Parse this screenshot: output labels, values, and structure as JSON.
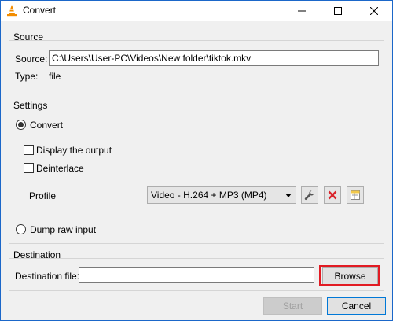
{
  "window": {
    "title": "Convert"
  },
  "source": {
    "group_title": "Source",
    "source_label": "Source:",
    "source_value": "C:\\Users\\User-PC\\Videos\\New folder\\tiktok.mkv",
    "type_label": "Type:",
    "type_value": "file"
  },
  "settings": {
    "group_title": "Settings",
    "convert_label": "Convert",
    "display_output_label": "Display the output",
    "deinterlace_label": "Deinterlace",
    "profile_label": "Profile",
    "profile_selected": "Video - H.264 + MP3 (MP4)",
    "dump_raw_label": "Dump raw input"
  },
  "destination": {
    "group_title": "Destination",
    "file_label": "Destination file:",
    "file_value": "",
    "browse_label": "Browse"
  },
  "footer": {
    "start_label": "Start",
    "cancel_label": "Cancel"
  },
  "colors": {
    "highlight": "#e21b23",
    "delete_icon": "#d9242b",
    "vlc_orange": "#f28c00"
  },
  "icons": {
    "app": "vlc-cone-icon",
    "wrench": "wrench-icon",
    "delete": "delete-x-icon",
    "new_profile": "new-profile-icon"
  }
}
